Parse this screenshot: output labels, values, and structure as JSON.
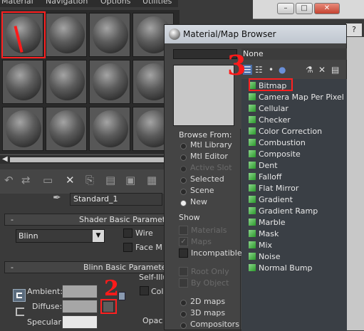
{
  "menubar": {
    "items": [
      "Material",
      "Navigation",
      "Options",
      "Utilities"
    ]
  },
  "editor": {
    "material_name": "Standard_1",
    "rollouts": {
      "shader_basic": "Shader Basic Parameters",
      "blinn_basic": "Blinn Basic Parameters"
    },
    "shader": "Blinn",
    "options": {
      "wire": "Wire",
      "face_map": "Face M"
    },
    "params": {
      "ambient": "Ambient:",
      "diffuse": "Diffuse:",
      "specular": "Specular:"
    },
    "self_illum": "Self-Illu",
    "self_illum_color": "Col",
    "opacity": "Opac"
  },
  "annotations": {
    "step2": "2",
    "step3": "3"
  },
  "browser": {
    "title": "Material/Map Browser",
    "current": "None",
    "browse_from": {
      "title": "Browse From:",
      "options": [
        {
          "label": "Mtl Library",
          "enabled": true,
          "selected": false
        },
        {
          "label": "Mtl Editor",
          "enabled": true,
          "selected": false
        },
        {
          "label": "Active Slot",
          "enabled": false,
          "selected": false
        },
        {
          "label": "Selected",
          "enabled": true,
          "selected": false
        },
        {
          "label": "Scene",
          "enabled": true,
          "selected": false
        },
        {
          "label": "New",
          "enabled": true,
          "selected": true
        }
      ]
    },
    "show": {
      "title": "Show",
      "options": [
        {
          "label": "Materials",
          "enabled": false,
          "checked": false
        },
        {
          "label": "Maps",
          "enabled": false,
          "checked": true
        },
        {
          "label": "Incompatible",
          "enabled": true,
          "checked": false
        }
      ],
      "extra": [
        {
          "label": "Root Only",
          "enabled": false
        },
        {
          "label": "By Object",
          "enabled": false
        }
      ]
    },
    "map_types": [
      {
        "label": "2D maps",
        "selected": false
      },
      {
        "label": "3D maps",
        "selected": false
      },
      {
        "label": "Compositors",
        "selected": false
      }
    ],
    "maps": [
      "Bitmap",
      "Camera Map Per Pixel",
      "Cellular",
      "Checker",
      "Color Correction",
      "Combustion",
      "Composite",
      "Dent",
      "Falloff",
      "Flat Mirror",
      "Gradient",
      "Gradient Ramp",
      "Marble",
      "Mask",
      "Mix",
      "Noise",
      "Normal Bump"
    ],
    "help": "?"
  },
  "window": {
    "minimize": "–",
    "maximize": "□",
    "close": "✕"
  }
}
